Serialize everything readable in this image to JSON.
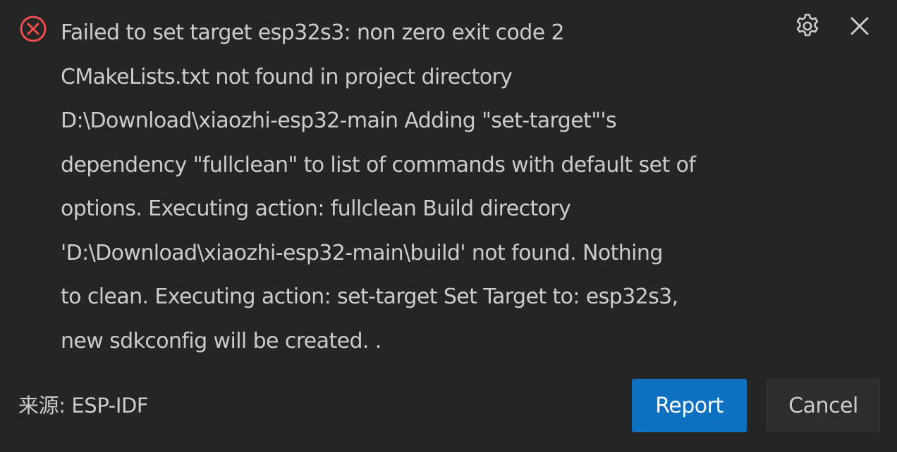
{
  "notification": {
    "severity_icon": "error-circle-x-icon",
    "message_lines": [
      "Failed to set target esp32s3: non zero exit code 2",
      "CMakeLists.txt not found in project directory",
      "D:\\Download\\xiaozhi-esp32-main Adding \"set-target\"'s",
      "dependency \"fullclean\" to list of commands with default set of",
      "options. Executing action: fullclean Build directory",
      "'D:\\Download\\xiaozhi-esp32-main\\build' not found. Nothing",
      "to clean. Executing action: set-target Set Target to: esp32s3,",
      "new sdkconfig will be created. ."
    ],
    "source_label": "来源: ESP-IDF",
    "settings_icon": "gear-icon",
    "close_icon": "close-icon"
  },
  "buttons": {
    "primary_label": "Report",
    "secondary_label": "Cancel"
  },
  "colors": {
    "background": "#252526",
    "text": "#cccccc",
    "error": "#f14c4c",
    "primary_button": "#0e70c0",
    "secondary_button": "#2d2d2d"
  }
}
